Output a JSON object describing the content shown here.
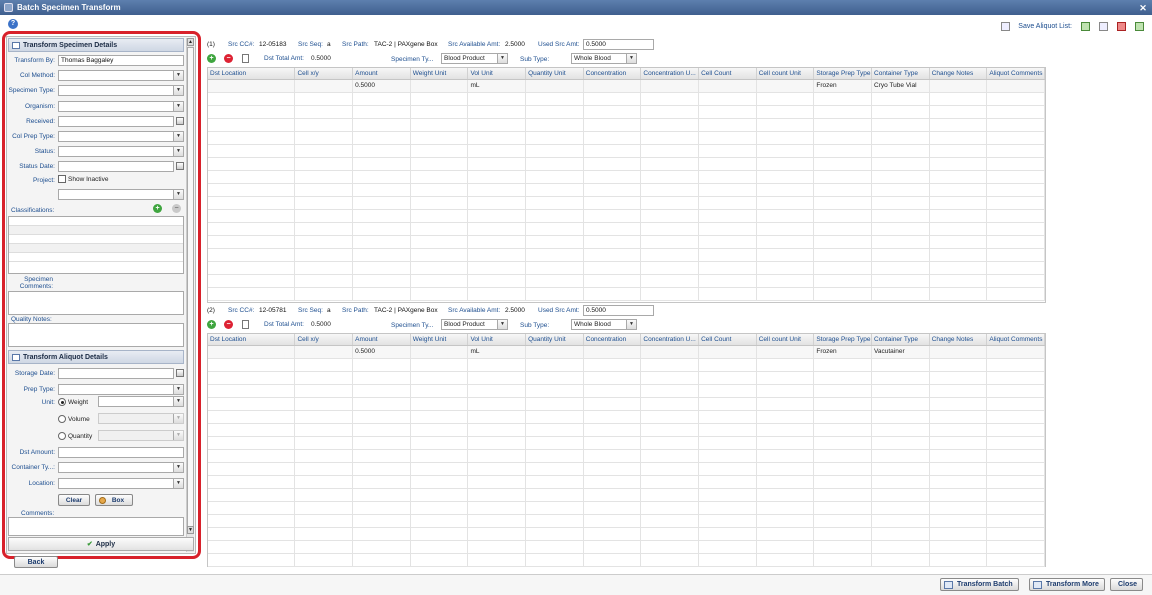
{
  "window": {
    "title": "Batch Specimen Transform"
  },
  "toolbar": {
    "save_aliquot_label": "Save Aliquot List:"
  },
  "left_panel": {
    "specimen_section_title": "Transform Specimen Details",
    "fields": {
      "transform_by": {
        "label": "Transform By:",
        "value": "Thomas Baggaley"
      },
      "col_method": {
        "label": "Col Method:",
        "value": ""
      },
      "specimen_type": {
        "label": "Specimen Type:",
        "value": ""
      },
      "organism": {
        "label": "Organism:",
        "value": ""
      },
      "received": {
        "label": "Received:",
        "value": ""
      },
      "col_prep_type": {
        "label": "Col Prep Type:",
        "value": ""
      },
      "status": {
        "label": "Status:",
        "value": ""
      },
      "status_date": {
        "label": "Status Date:",
        "value": ""
      },
      "project": {
        "label": "Project:",
        "show_inactive": "Show Inactive",
        "value": ""
      }
    },
    "classifications_label": "Classifications:",
    "specimen_comments_label": "Specimen Comments:",
    "quality_notes_label": "Quality Notes:",
    "aliquot_section_title": "Transform Aliquot Details",
    "aliquot_fields": {
      "storage_date": {
        "label": "Storage Date:",
        "value": ""
      },
      "prep_type": {
        "label": "Prep Type:",
        "value": ""
      },
      "unit": {
        "label": "Unit:",
        "options": [
          "Weight",
          "Volume",
          "Quantity"
        ],
        "selected": "Weight"
      },
      "dst_amount": {
        "label": "Dst Amount:",
        "value": ""
      },
      "container_type": {
        "label": "Container Ty...:",
        "value": ""
      },
      "location": {
        "label": "Location:",
        "value": ""
      }
    },
    "clear_label": "Clear",
    "box_label": "Box",
    "comments_label": "Comments:",
    "apply_label": "Apply"
  },
  "columns": [
    "Dst Location",
    "Cell x/y",
    "Amount",
    "Weight Unit",
    "Vol Unit",
    "Quantity Unit",
    "Concentration",
    "Concentration U...",
    "Cell Count",
    "Cell count Unit",
    "Storage Prep Type",
    "Container Type",
    "Change Notes",
    "Aliquot Comments"
  ],
  "labels": {
    "src_cc": "Src CC#:",
    "src_seq": "Src Seq:",
    "src_path": "Src Path:",
    "src_avail": "Src Available Amt:",
    "used_src": "Used Src Amt:",
    "dst_total": "Dst Total Amt:",
    "specimen_ty": "Specimen Ty...",
    "sub_type": "Sub Type:"
  },
  "batches": [
    {
      "index": "(1)",
      "src_cc": "12-05183",
      "src_seq": "a",
      "src_path": "TAC-2 | PAXgene Box",
      "src_available_amt": "2.5000",
      "used_src_amt": "0.5000",
      "dst_total_amt": "0.5000",
      "specimen_type": "Blood Product",
      "sub_type": "Whole Blood",
      "rows": [
        [
          "",
          "",
          "0.5000",
          "",
          "mL",
          "",
          "",
          "",
          "",
          "",
          "Frozen",
          "Cryo Tube Vial",
          "",
          ""
        ]
      ]
    },
    {
      "index": "(2)",
      "src_cc": "12-05781",
      "src_seq": "a",
      "src_path": "TAC-2 | PAXgene Box",
      "src_available_amt": "2.5000",
      "used_src_amt": "0.5000",
      "dst_total_amt": "0.5000",
      "specimen_type": "Blood Product",
      "sub_type": "Whole Blood",
      "rows": [
        [
          "",
          "",
          "0.5000",
          "",
          "mL",
          "",
          "",
          "",
          "",
          "",
          "Frozen",
          "Vacutainer",
          "",
          ""
        ]
      ]
    }
  ],
  "footer": {
    "back_label": "Back",
    "transform_batch_label": "Transform Batch",
    "transform_more_label": "Transform More",
    "close_label": "Close"
  }
}
